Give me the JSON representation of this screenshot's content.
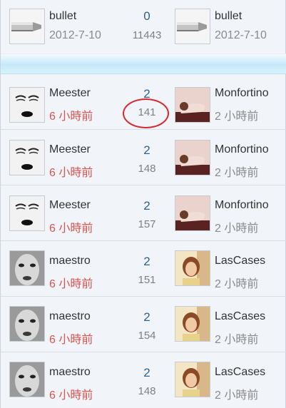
{
  "rows": [
    {
      "left_name": "bullet",
      "left_time": "2012-7-10",
      "left_avatar": "bullet-icon",
      "replies": "0",
      "views": "11443",
      "right_name": "bullet",
      "right_time": "2012-7-10",
      "right_avatar": "bullet-icon"
    },
    {
      "left_name": "Meester",
      "left_time": "6 小時前",
      "left_avatar": "face-sketch-avatar",
      "replies": "2",
      "views": "141",
      "right_name": "Monfortino",
      "right_time": "2 小時前",
      "right_avatar": "pose-photo-avatar"
    },
    {
      "left_name": "Meester",
      "left_time": "6 小時前",
      "left_avatar": "face-sketch-avatar",
      "replies": "2",
      "views": "148",
      "right_name": "Monfortino",
      "right_time": "2 小時前",
      "right_avatar": "pose-photo-avatar"
    },
    {
      "left_name": "Meester",
      "left_time": "6 小時前",
      "left_avatar": "face-sketch-avatar",
      "replies": "2",
      "views": "157",
      "right_name": "Monfortino",
      "right_time": "2 小時前",
      "right_avatar": "pose-photo-avatar"
    },
    {
      "left_name": "maestro",
      "left_time": "6 小時前",
      "left_avatar": "face-bw-avatar",
      "replies": "2",
      "views": "151",
      "right_name": "LasCases",
      "right_time": "2 小時前",
      "right_avatar": "girl-photo-avatar"
    },
    {
      "left_name": "maestro",
      "left_time": "6 小時前",
      "left_avatar": "face-bw-avatar",
      "replies": "2",
      "views": "154",
      "right_name": "LasCases",
      "right_time": "2 小時前",
      "right_avatar": "girl-photo-avatar"
    },
    {
      "left_name": "maestro",
      "left_time": "6 小時前",
      "left_avatar": "face-bw-avatar",
      "replies": "2",
      "views": "148",
      "right_name": "LasCases",
      "right_time": "2 小時前",
      "right_avatar": "girl-photo-avatar"
    }
  ],
  "colors": {
    "time_recent_left": "#d9534f",
    "time_right": "#8a8a8a",
    "reply_count": "#2c6291",
    "banner": "#c5e9f8",
    "highlight": "#d8272c"
  }
}
